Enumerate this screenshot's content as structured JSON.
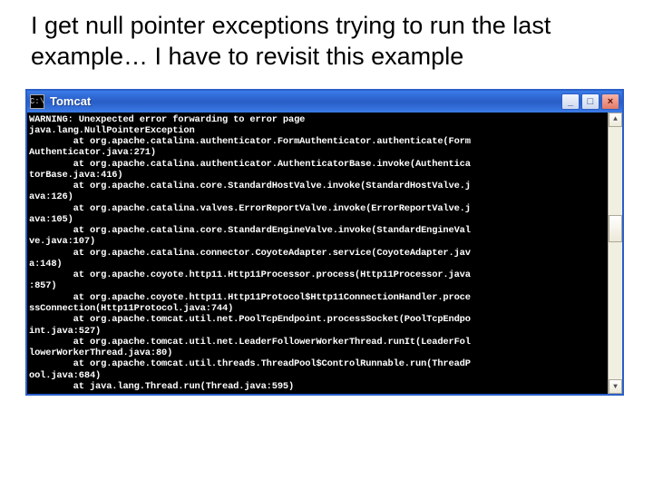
{
  "heading": "I get null pointer exceptions trying to run the last example… I have to revisit this example",
  "window": {
    "icon_label": "cmd-icon",
    "icon_glyph": "C:\\",
    "title": "Tomcat",
    "buttons": {
      "minimize": "_",
      "maximize": "□",
      "close": "×"
    }
  },
  "scrollbar": {
    "up": "▲",
    "down": "▼"
  },
  "console_lines": [
    "WARNING: Unexpected error forwarding to error page",
    "java.lang.NullPointerException",
    "        at org.apache.catalina.authenticator.FormAuthenticator.authenticate(Form",
    "Authenticator.java:271)",
    "        at org.apache.catalina.authenticator.AuthenticatorBase.invoke(Authentica",
    "torBase.java:416)",
    "        at org.apache.catalina.core.StandardHostValve.invoke(StandardHostValve.j",
    "ava:126)",
    "        at org.apache.catalina.valves.ErrorReportValve.invoke(ErrorReportValve.j",
    "ava:105)",
    "        at org.apache.catalina.core.StandardEngineValve.invoke(StandardEngineVal",
    "ve.java:107)",
    "        at org.apache.catalina.connector.CoyoteAdapter.service(CoyoteAdapter.jav",
    "a:148)",
    "        at org.apache.coyote.http11.Http11Processor.process(Http11Processor.java",
    ":857)",
    "        at org.apache.coyote.http11.Http11Protocol$Http11ConnectionHandler.proce",
    "ssConnection(Http11Protocol.java:744)",
    "        at org.apache.tomcat.util.net.PoolTcpEndpoint.processSocket(PoolTcpEndpo",
    "int.java:527)",
    "        at org.apache.tomcat.util.net.LeaderFollowerWorkerThread.runIt(LeaderFol",
    "lowerWorkerThread.java:80)",
    "        at org.apache.tomcat.util.threads.ThreadPool$ControlRunnable.run(ThreadP",
    "ool.java:684)",
    "        at java.lang.Thread.run(Thread.java:595)"
  ]
}
